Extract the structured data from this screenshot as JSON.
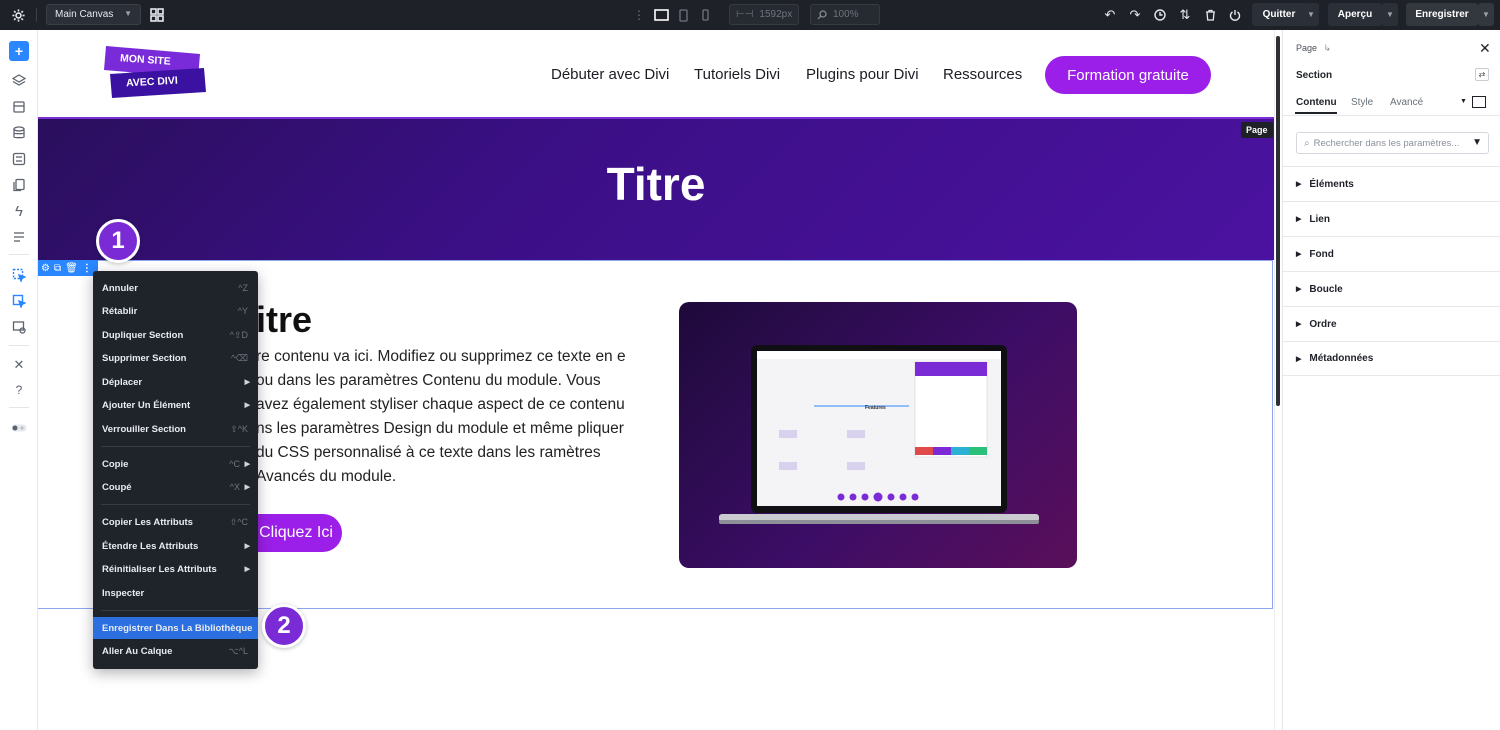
{
  "topbar": {
    "canvas_label": "Main Canvas",
    "width_value": "1592px",
    "zoom_value": "100%",
    "quit_label": "Quitter",
    "preview_label": "Aperçu",
    "save_label": "Enregistrer"
  },
  "site": {
    "logo_line1": "MON SITE",
    "logo_line2": "AVEC DIVI",
    "nav": [
      "Débuter avec Divi",
      "Tutoriels Divi",
      "Plugins pour Divi",
      "Ressources"
    ],
    "cta_label": "Formation gratuite",
    "hero_title": "Titre",
    "page_tag": "Page",
    "section_title": "itre",
    "section_body": "re contenu va ici. Modifiez ou supprimez ce texte en e ou dans les paramètres Contenu du module. Vous avez également styliser chaque aspect de ce contenu ns les paramètres Design du module et même pliquer du CSS personnalisé à ce texte dans les ramètres Avancés du module.",
    "section_button": "Cliquez Ici",
    "mockup_heading": "Features"
  },
  "context_menu": {
    "items": [
      {
        "label": "Annuler",
        "shortcut": "^Z"
      },
      {
        "label": "Rétablir",
        "shortcut": "^Y"
      },
      {
        "label": "Dupliquer Section",
        "shortcut": "^⇧D"
      },
      {
        "label": "Supprimer Section",
        "shortcut": "^⌫"
      },
      {
        "label": "Déplacer",
        "shortcut": ""
      },
      {
        "label": "Ajouter Un Élément",
        "shortcut": ""
      },
      {
        "label": "Verrouiller Section",
        "shortcut": "⇧^K"
      },
      {
        "label": "Copie",
        "shortcut": "^C"
      },
      {
        "label": "Coupé",
        "shortcut": "^X"
      },
      {
        "label": "Copier Les Attributs",
        "shortcut": "⇧^C"
      },
      {
        "label": "Étendre Les Attributs",
        "shortcut": ""
      },
      {
        "label": "Réinitialiser Les Attributs",
        "shortcut": ""
      },
      {
        "label": "Inspecter",
        "shortcut": ""
      },
      {
        "label": "Enregistrer Dans La Bibliothèque",
        "shortcut": ""
      },
      {
        "label": "Aller Au Calque",
        "shortcut": "⌥^L"
      }
    ]
  },
  "badges": {
    "one": "1",
    "two": "2"
  },
  "right_panel": {
    "breadcrumb": "Page",
    "title": "Section",
    "tabs": [
      "Contenu",
      "Style",
      "Avancé"
    ],
    "search_placeholder": "Rechercher dans les paramètres...",
    "groups": [
      "Éléments",
      "Lien",
      "Fond",
      "Boucle",
      "Ordre",
      "Métadonnées"
    ]
  },
  "colors": {
    "accent": "#9b1fe8",
    "builder_blue": "#2b87ff",
    "badge_purple": "#7b2bd6",
    "dark_ui": "#1e2128"
  }
}
